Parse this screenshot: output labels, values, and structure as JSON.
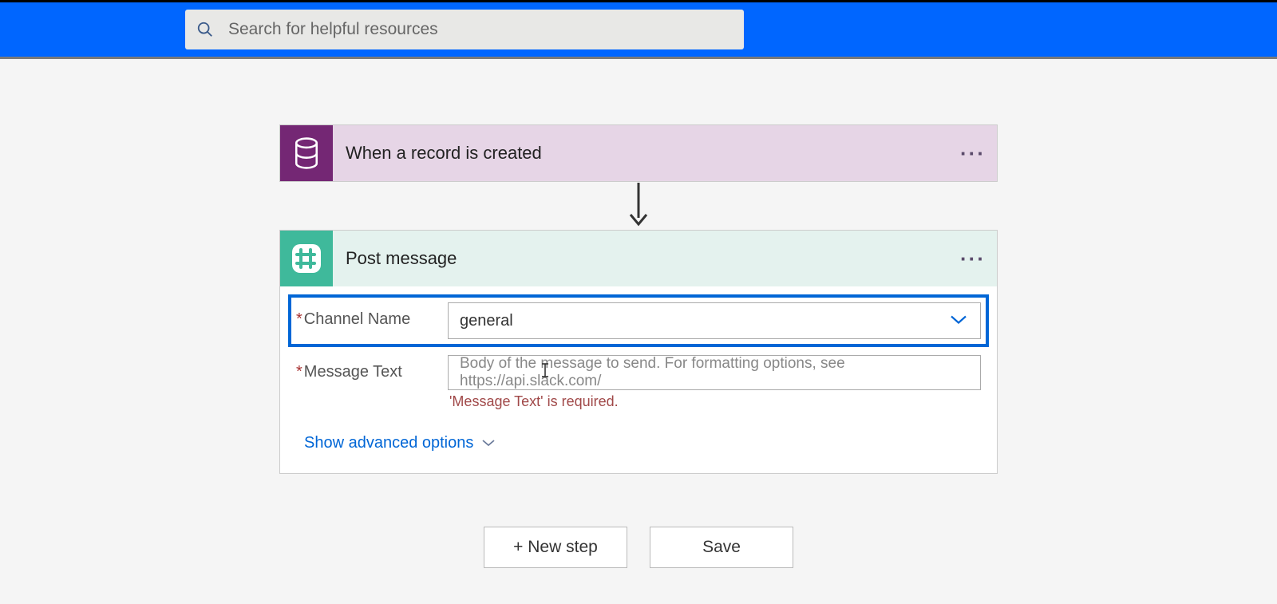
{
  "header": {
    "search_placeholder": "Search for helpful resources"
  },
  "trigger": {
    "title": "When a record is created"
  },
  "action": {
    "title": "Post message",
    "fields": {
      "channel_label": "Channel Name",
      "channel_value": "general",
      "message_label": "Message Text",
      "message_placeholder": "Body of the message to send. For formatting options, see https://api.slack.com/",
      "message_error": "'Message Text' is required."
    },
    "advanced_label": "Show advanced options"
  },
  "footer": {
    "new_step_label": "+ New step",
    "save_label": "Save"
  }
}
